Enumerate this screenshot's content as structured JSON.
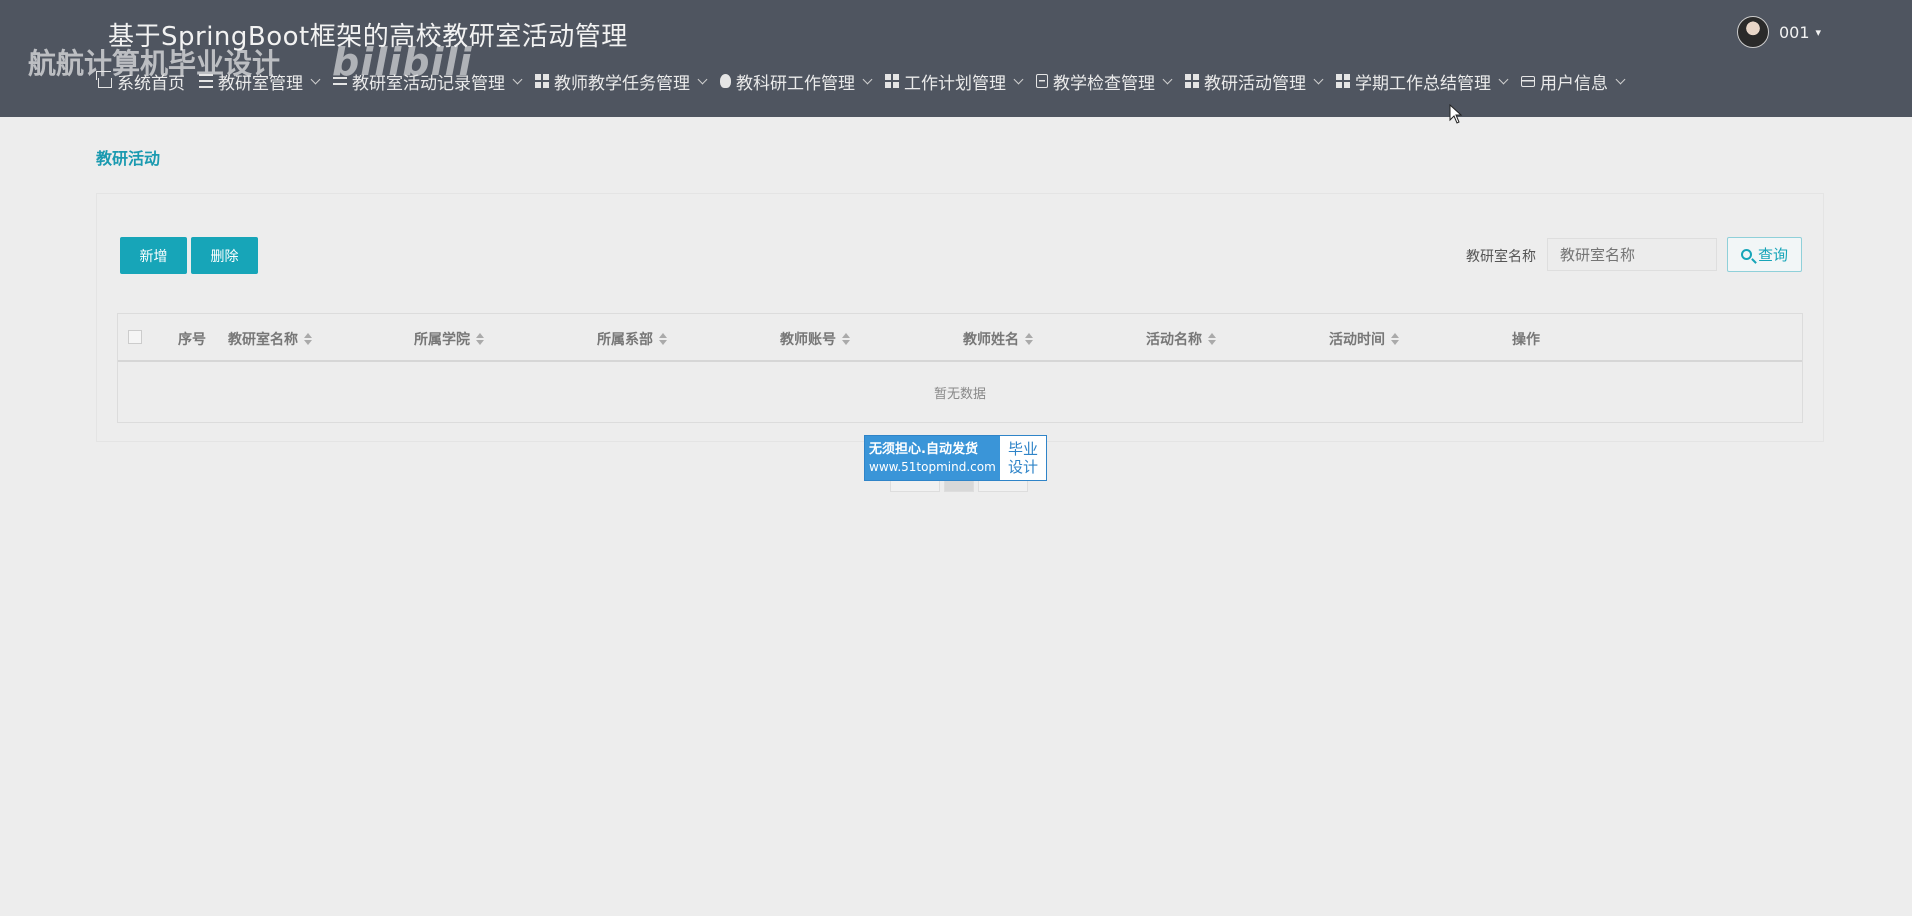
{
  "header": {
    "site_title": "基于SpringBoot框架的高校教研室活动管理",
    "watermark_text": "航航计算机毕业设计",
    "watermark_logo": "bilibili",
    "user": {
      "name": "001",
      "caret": "▾"
    },
    "nav": [
      {
        "label": "系统首页",
        "icon": "home-icon",
        "has_caret": false
      },
      {
        "label": "教研室管理",
        "icon": "list-icon",
        "has_caret": true
      },
      {
        "label": "教研室活动记录管理",
        "icon": "swap-icon",
        "has_caret": true
      },
      {
        "label": "教师教学任务管理",
        "icon": "grid-icon",
        "has_caret": true
      },
      {
        "label": "教科研工作管理",
        "icon": "bulb-icon",
        "has_caret": true
      },
      {
        "label": "工作计划管理",
        "icon": "grid-icon",
        "has_caret": true
      },
      {
        "label": "教学检查管理",
        "icon": "clipboard-icon",
        "has_caret": true
      },
      {
        "label": "教研活动管理",
        "icon": "grid-icon",
        "has_caret": true
      },
      {
        "label": "学期工作总结管理",
        "icon": "grid-icon",
        "has_caret": true
      },
      {
        "label": "用户信息",
        "icon": "card-icon",
        "has_caret": true
      }
    ]
  },
  "breadcrumb": "教研活动",
  "toolbar": {
    "add_label": "新增",
    "delete_label": "删除",
    "search_label": "教研室名称",
    "search_placeholder": "教研室名称",
    "search_button": "查询"
  },
  "table": {
    "columns": [
      "序号",
      "教研室名称",
      "所属学院",
      "所属系部",
      "教师账号",
      "教师姓名",
      "活动名称",
      "活动时间",
      "操作"
    ],
    "empty_text": "暂无数据"
  },
  "ad": {
    "line1": "无须担心.自动发货",
    "line2": "www.51topmind.com",
    "right1": "毕业",
    "right2": "设计"
  },
  "colors": {
    "header_bg": "#4f5560",
    "accent": "#17a5b8",
    "page_bg": "#ededed"
  }
}
